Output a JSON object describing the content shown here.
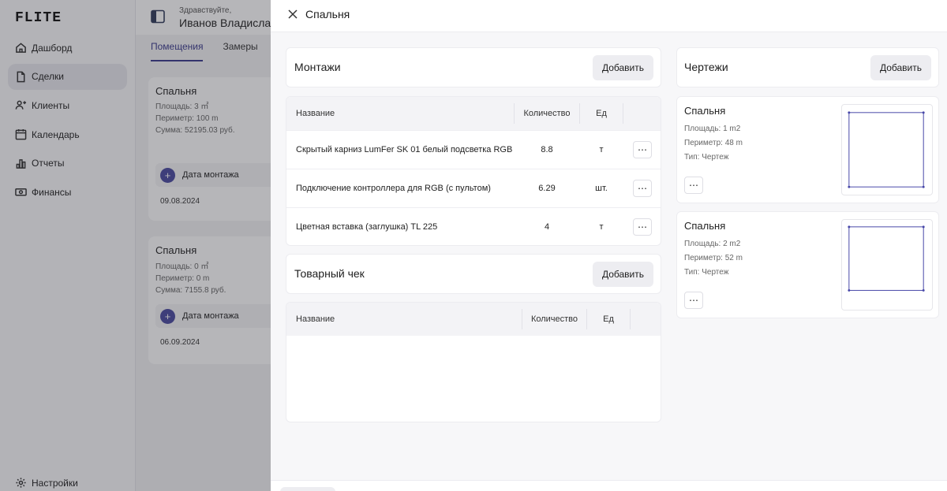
{
  "app": {
    "logo": "FLITE"
  },
  "sidebar": {
    "items": [
      {
        "label": "Дашборд",
        "icon": "home-icon",
        "active": false
      },
      {
        "label": "Сделки",
        "icon": "file-icon",
        "active": true
      },
      {
        "label": "Клиенты",
        "icon": "users-icon",
        "active": false
      },
      {
        "label": "Календарь",
        "icon": "calendar-icon",
        "active": false
      },
      {
        "label": "Отчеты",
        "icon": "bar-chart-icon",
        "active": false
      },
      {
        "label": "Финансы",
        "icon": "money-icon",
        "active": false
      }
    ],
    "settings_label": "Настройки"
  },
  "header": {
    "greeting": "Здравствуйте,",
    "user_name": "Иванов Владислав"
  },
  "tabs": [
    {
      "label": "Помещения",
      "active": true
    },
    {
      "label": "Замеры",
      "active": false
    }
  ],
  "rooms": [
    {
      "title": "Спальня",
      "area": "Площадь: 3 ㎡",
      "perimeter": "Периметр: 100 m",
      "sum": "Сумма: 52195.03 руб.",
      "mount_label": "Дата монтажа",
      "mount_date": "09.08.2024"
    },
    {
      "title": "Спальня",
      "area": "Площадь: 0 ㎡",
      "perimeter": "Периметр: 0 m",
      "sum": "Сумма: 7155.8 руб.",
      "mount_label": "Дата монтажа",
      "mount_date": "06.09.2024"
    }
  ],
  "drawer": {
    "title": "Спальня",
    "montazhi": {
      "title": "Монтажи",
      "add_label": "Добавить",
      "columns": {
        "name": "Название",
        "qty": "Количество",
        "unit": "Ед"
      },
      "rows": [
        {
          "name": "Скрытый карниз LumFer SK 01 белый подсветка RGB",
          "qty": "8.8",
          "unit": "т"
        },
        {
          "name": "Подключение контроллера для RGB (с пультом)",
          "qty": "6.29",
          "unit": "шт."
        },
        {
          "name": "Цветная вставка (заглушка) TL 225",
          "qty": "4",
          "unit": "т"
        }
      ]
    },
    "receipt": {
      "title": "Товарный чек",
      "add_label": "Добавить",
      "columns": {
        "name": "Название",
        "qty": "Количество",
        "unit": "Ед"
      }
    },
    "drawings": {
      "title": "Чертежи",
      "add_label": "Добавить",
      "items": [
        {
          "title": "Спальня",
          "area": "Площадь: 1 m2",
          "perimeter": "Периметр: 48 m",
          "type": "Тип: Чертеж"
        },
        {
          "title": "Спальня",
          "area": "Площадь: 2 m2",
          "perimeter": "Периметр: 52 m",
          "type": "Тип: Чертеж"
        }
      ]
    }
  },
  "colors": {
    "accent": "#3a3a8c",
    "plus_button": "#4a4aa0",
    "drawing_line": "#4646a8"
  }
}
